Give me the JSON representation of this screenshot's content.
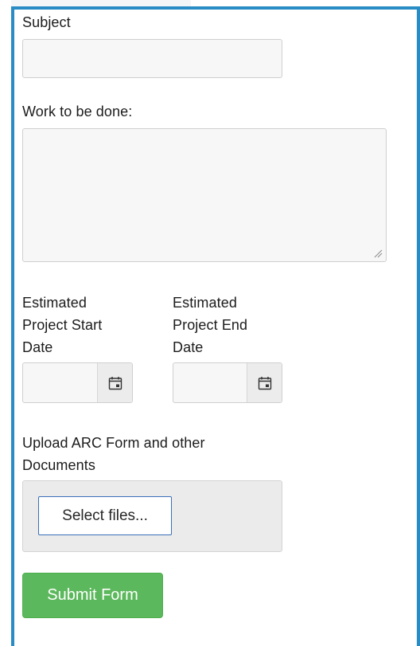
{
  "form": {
    "subject": {
      "label": "Subject",
      "value": ""
    },
    "work": {
      "label": "Work to be done:",
      "value": ""
    },
    "start_date": {
      "label_line1": "Estimated",
      "label_line2": "Project Start",
      "label_line3": "Date",
      "value": "",
      "icon": "calendar-icon"
    },
    "end_date": {
      "label_line1": "Estimated",
      "label_line2": "Project End",
      "label_line3": "Date",
      "value": "",
      "icon": "calendar-icon"
    },
    "upload": {
      "label_line1": "Upload ARC Form and other",
      "label_line2": "Documents",
      "button_label": "Select files..."
    },
    "submit_label": "Submit Form"
  },
  "colors": {
    "frame_border": "#2a8cc4",
    "submit_bg": "#5cb85c",
    "select_files_border": "#3a6fb7"
  }
}
